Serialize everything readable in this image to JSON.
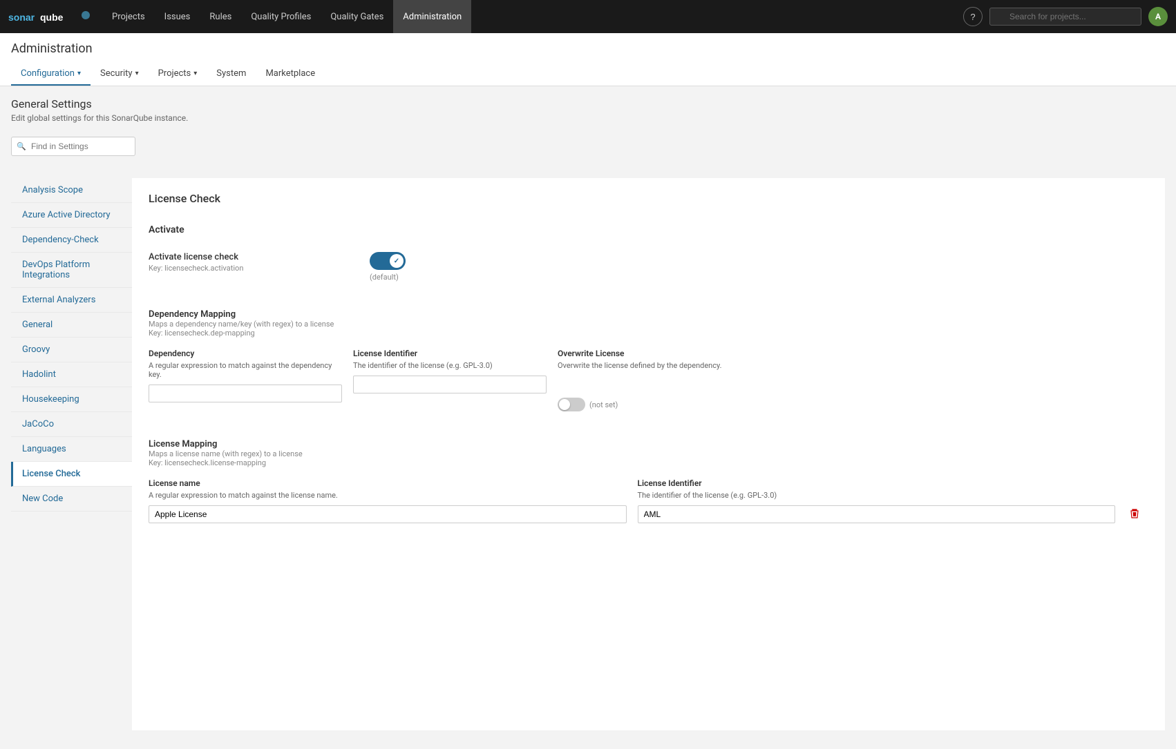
{
  "topNav": {
    "logo_alt": "SonarQube",
    "items": [
      {
        "label": "Projects",
        "active": false
      },
      {
        "label": "Issues",
        "active": false
      },
      {
        "label": "Rules",
        "active": false
      },
      {
        "label": "Quality Profiles",
        "active": false
      },
      {
        "label": "Quality Gates",
        "active": false
      },
      {
        "label": "Administration",
        "active": true
      }
    ],
    "search_placeholder": "Search for projects...",
    "user_initial": "A"
  },
  "page": {
    "title": "Administration",
    "sub_nav": [
      {
        "label": "Configuration",
        "active": true,
        "has_dropdown": true
      },
      {
        "label": "Security",
        "active": false,
        "has_dropdown": true
      },
      {
        "label": "Projects",
        "active": false,
        "has_dropdown": true
      },
      {
        "label": "System",
        "active": false,
        "has_dropdown": false
      },
      {
        "label": "Marketplace",
        "active": false,
        "has_dropdown": false
      }
    ]
  },
  "generalSettings": {
    "title": "General Settings",
    "subtitle": "Edit global settings for this SonarQube instance.",
    "search_placeholder": "Find in Settings"
  },
  "sidebar": {
    "items": [
      {
        "label": "Analysis Scope",
        "active": false
      },
      {
        "label": "Azure Active Directory",
        "active": false
      },
      {
        "label": "Dependency-Check",
        "active": false
      },
      {
        "label": "DevOps Platform Integrations",
        "active": false
      },
      {
        "label": "External Analyzers",
        "active": false
      },
      {
        "label": "General",
        "active": false
      },
      {
        "label": "Groovy",
        "active": false
      },
      {
        "label": "Hadolint",
        "active": false
      },
      {
        "label": "Housekeeping",
        "active": false
      },
      {
        "label": "JaCoCo",
        "active": false
      },
      {
        "label": "Languages",
        "active": false
      },
      {
        "label": "License Check",
        "active": true
      },
      {
        "label": "New Code",
        "active": false
      }
    ]
  },
  "content": {
    "section_title": "License Check",
    "activate": {
      "group_title": "Activate",
      "label": "Activate license check",
      "key": "Key: licensecheck.activation",
      "enabled": true,
      "default_label": "(default)"
    },
    "dependency_mapping": {
      "group_title": "Dependency Mapping",
      "description": "Maps a dependency name/key (with regex) to a license",
      "key": "Key: licensecheck.dep-mapping",
      "dependency": {
        "header": "Dependency",
        "desc": "A regular expression to match against the dependency key.",
        "value": ""
      },
      "license_identifier": {
        "header": "License Identifier",
        "desc": "The identifier of the license (e.g. GPL-3.0)",
        "value": ""
      },
      "overwrite_license": {
        "header": "Overwrite License",
        "desc": "Overwrite the license defined by the dependency.",
        "enabled": false,
        "not_set_label": "(not set)"
      }
    },
    "license_mapping": {
      "group_title": "License Mapping",
      "description": "Maps a license name (with regex) to a license",
      "key": "Key: licensecheck.license-mapping",
      "license_name": {
        "header": "License name",
        "desc": "A regular expression to match against the license name.",
        "value": "Apple License"
      },
      "license_identifier": {
        "header": "License Identifier",
        "desc": "The identifier of the license (e.g. GPL-3.0)",
        "value": "AML"
      }
    }
  }
}
